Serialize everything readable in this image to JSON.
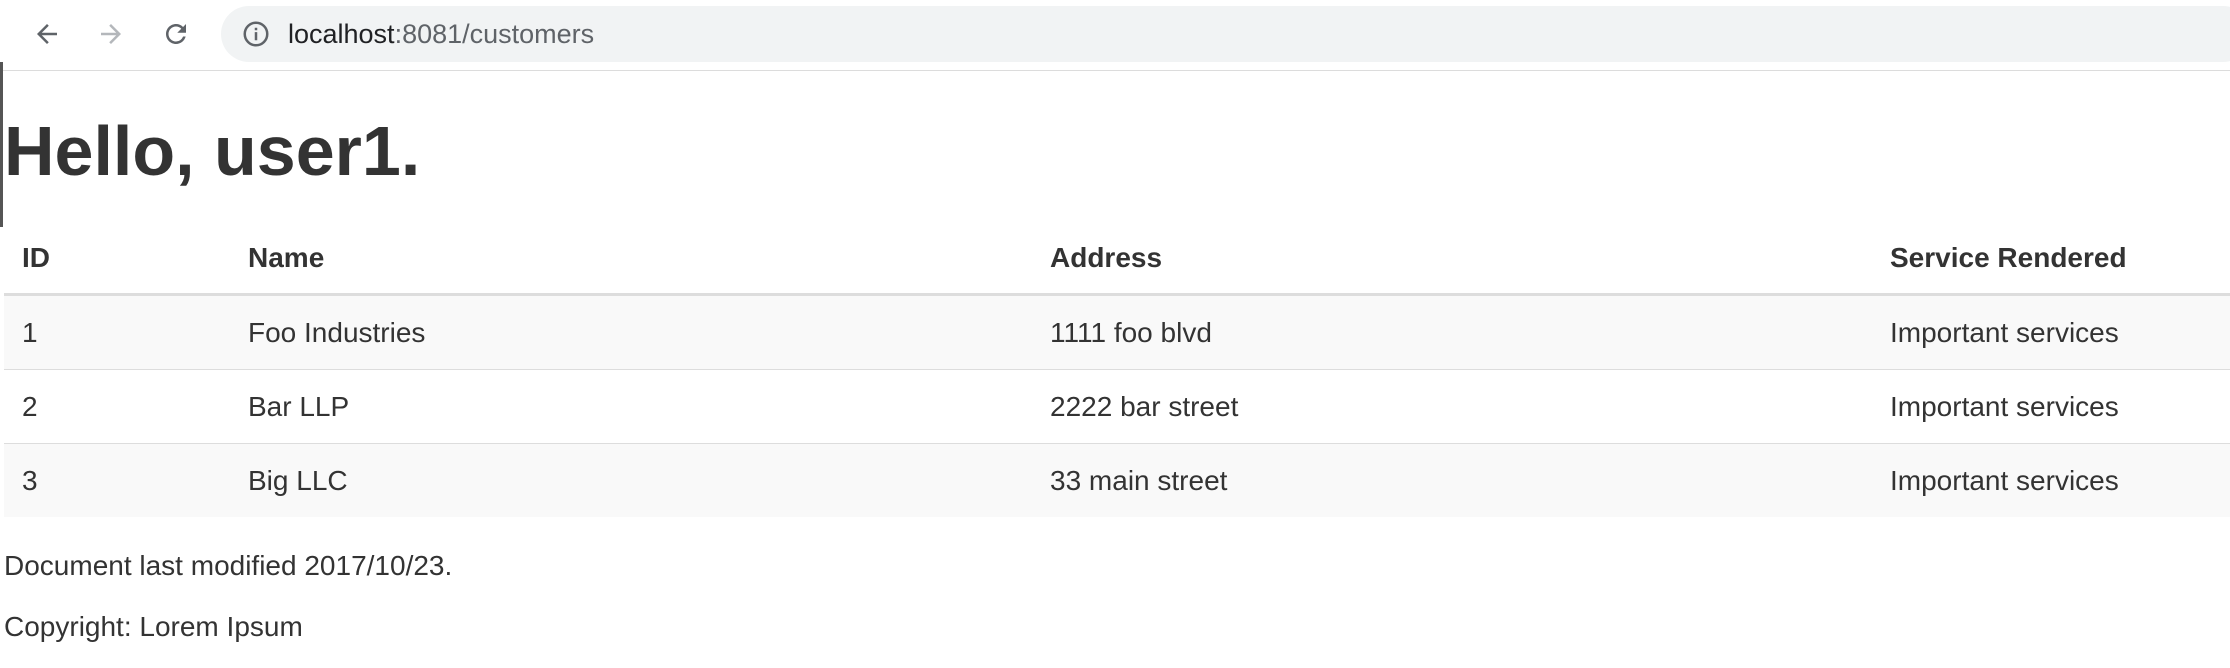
{
  "browser": {
    "url_host": "localhost",
    "url_rest": ":8081/customers",
    "icons": {
      "back": "back-arrow-icon",
      "forward": "forward-arrow-icon",
      "reload": "reload-icon",
      "site_info": "info-icon"
    },
    "forward_disabled": true
  },
  "page": {
    "title": "Hello, user1.",
    "table": {
      "headers": [
        "ID",
        "Name",
        "Address",
        "Service Rendered"
      ],
      "rows": [
        [
          "1",
          "Foo Industries",
          "1111 foo blvd",
          "Important services"
        ],
        [
          "2",
          "Bar LLP",
          "2222 bar street",
          "Important services"
        ],
        [
          "3",
          "Big LLC",
          "33 main street",
          "Important services"
        ]
      ]
    },
    "footer": {
      "last_modified": "Document last modified 2017/10/23.",
      "copyright": "Copyright: Lorem Ipsum"
    }
  },
  "colors": {
    "text": "#333333",
    "omnibox_bg": "#f1f3f4",
    "row_stripe": "#f9f9f9",
    "border": "#dddddd"
  }
}
